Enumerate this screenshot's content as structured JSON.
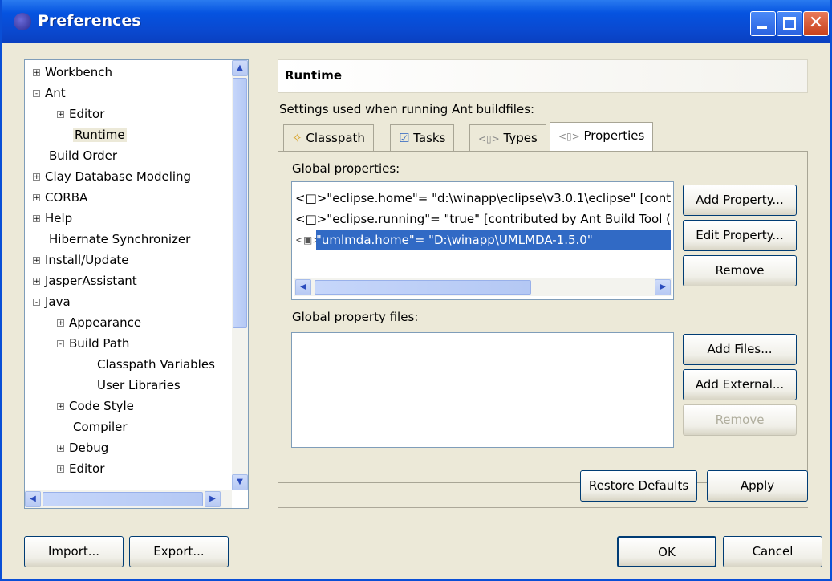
{
  "window": {
    "title": "Preferences"
  },
  "tree": {
    "items": [
      {
        "label": "Workbench",
        "pm": "+"
      },
      {
        "label": "Ant",
        "pm": "-"
      },
      {
        "label": "Editor",
        "pm": "+"
      },
      {
        "label": "Runtime",
        "pm": ""
      },
      {
        "label": "Build Order",
        "pm": ""
      },
      {
        "label": "Clay Database Modeling",
        "pm": "+"
      },
      {
        "label": "CORBA",
        "pm": "+"
      },
      {
        "label": "Help",
        "pm": "+"
      },
      {
        "label": "Hibernate Synchronizer",
        "pm": ""
      },
      {
        "label": "Install/Update",
        "pm": "+"
      },
      {
        "label": "JasperAssistant",
        "pm": "+"
      },
      {
        "label": "Java",
        "pm": "-"
      },
      {
        "label": "Appearance",
        "pm": "+"
      },
      {
        "label": "Build Path",
        "pm": "-"
      },
      {
        "label": "Classpath Variables",
        "pm": ""
      },
      {
        "label": "User Libraries",
        "pm": ""
      },
      {
        "label": "Code Style",
        "pm": "+"
      },
      {
        "label": "Compiler",
        "pm": ""
      },
      {
        "label": "Debug",
        "pm": "+"
      },
      {
        "label": "Editor",
        "pm": "+"
      }
    ]
  },
  "panel": {
    "title": "Runtime",
    "description": "Settings used when running Ant buildfiles:",
    "tabs": [
      "Classpath",
      "Tasks",
      "Types",
      "Properties"
    ],
    "global_properties_label": "Global properties:",
    "properties": [
      "<□>\"eclipse.home\"= \"d:\\winapp\\eclipse\\v3.0.1\\eclipse\" [cont",
      "<□>\"eclipse.running\"= \"true\" [contributed by Ant Build Tool (",
      "\"umlmda.home\"= \"D:\\winapp\\UMLMDA-1.5.0\""
    ],
    "selected_icon": "<▣>",
    "global_property_files_label": "Global property files:",
    "buttons": {
      "add_property": "Add Property...",
      "edit_property": "Edit Property...",
      "remove": "Remove",
      "add_files": "Add Files...",
      "add_external": "Add External...",
      "remove_files": "Remove"
    },
    "restore_defaults": "Restore Defaults",
    "apply": "Apply"
  },
  "footer": {
    "import": "Import...",
    "export": "Export...",
    "ok": "OK",
    "cancel": "Cancel"
  }
}
